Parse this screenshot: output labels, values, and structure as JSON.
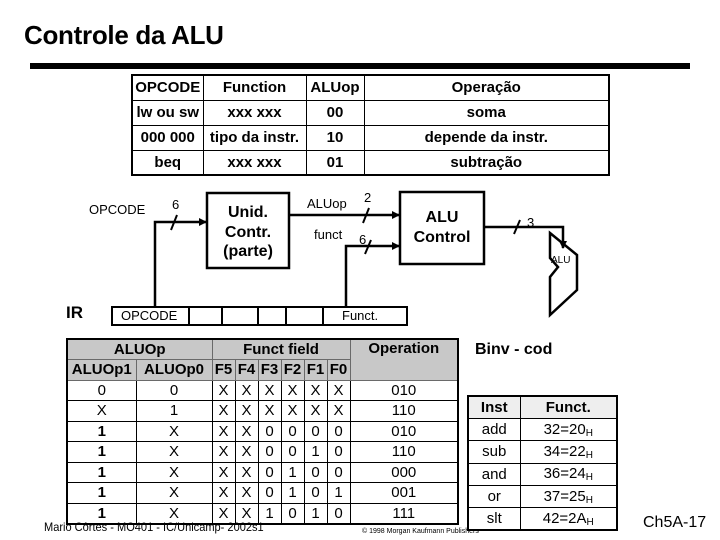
{
  "title": "Controle da ALU",
  "top_table": {
    "headers": [
      "OPCODE",
      "Function",
      "ALUop",
      "Operação"
    ],
    "rows": [
      [
        "lw ou sw",
        "xxx xxx",
        "00",
        "soma"
      ],
      [
        "000 000",
        "tipo da instr.",
        "10",
        "depende da instr."
      ],
      [
        "beq",
        "xxx xxx",
        "01",
        "subtração"
      ]
    ]
  },
  "diagram": {
    "opcode_label": "OPCODE",
    "opcode_width": "6",
    "control_unit": [
      "Unid.",
      "Contr.",
      "(parte)"
    ],
    "aluop_label": "ALUop",
    "aluop_width": "2",
    "funct_label": "funct",
    "funct_width": "6",
    "alu_control": [
      "ALU",
      "Control"
    ],
    "alu_control_width": "3",
    "alu_label": "ALU",
    "ir_label": "IR",
    "ir_fields": [
      "OPCODE",
      "",
      "",
      "",
      "",
      "Funct."
    ]
  },
  "truth_table": {
    "group_headers": [
      "ALUOp",
      "Funct field",
      "Operation"
    ],
    "sub_headers": [
      "ALUOp1",
      "ALUOp0",
      "F5",
      "F4",
      "F3",
      "F2",
      "F1",
      "F0"
    ],
    "rows": [
      [
        "0",
        "0",
        "X",
        "X",
        "X",
        "X",
        "X",
        "X",
        "010"
      ],
      [
        "X",
        "1",
        "X",
        "X",
        "X",
        "X",
        "X",
        "X",
        "110"
      ],
      [
        "1",
        "X",
        "X",
        "X",
        "0",
        "0",
        "0",
        "0",
        "010"
      ],
      [
        "1",
        "X",
        "X",
        "X",
        "0",
        "0",
        "1",
        "0",
        "110"
      ],
      [
        "1",
        "X",
        "X",
        "X",
        "0",
        "1",
        "0",
        "0",
        "000"
      ],
      [
        "1",
        "X",
        "X",
        "X",
        "0",
        "1",
        "0",
        "1",
        "001"
      ],
      [
        "1",
        "X",
        "X",
        "X",
        "1",
        "0",
        "1",
        "0",
        "111"
      ]
    ]
  },
  "binv_label": "Binv - cod",
  "inst_table": {
    "headers": [
      "Inst",
      "Funct."
    ],
    "rows": [
      {
        "inst": "add",
        "dec": "32=20",
        "hex_sub": "H"
      },
      {
        "inst": "sub",
        "dec": "34=22",
        "hex_sub": "H"
      },
      {
        "inst": "and",
        "dec": "36=24",
        "hex_sub": "H"
      },
      {
        "inst": "or",
        "dec": "37=25",
        "hex_sub": "H"
      },
      {
        "inst": "slt",
        "dec": "42=2A",
        "hex_sub": "H"
      }
    ]
  },
  "footer": {
    "author": "Mario Côrtes - MO401 - IC/Unicamp- 2002s1",
    "copyright": "© 1998 Morgan Kaufmann Publishers",
    "slide": "Ch5A-17"
  }
}
